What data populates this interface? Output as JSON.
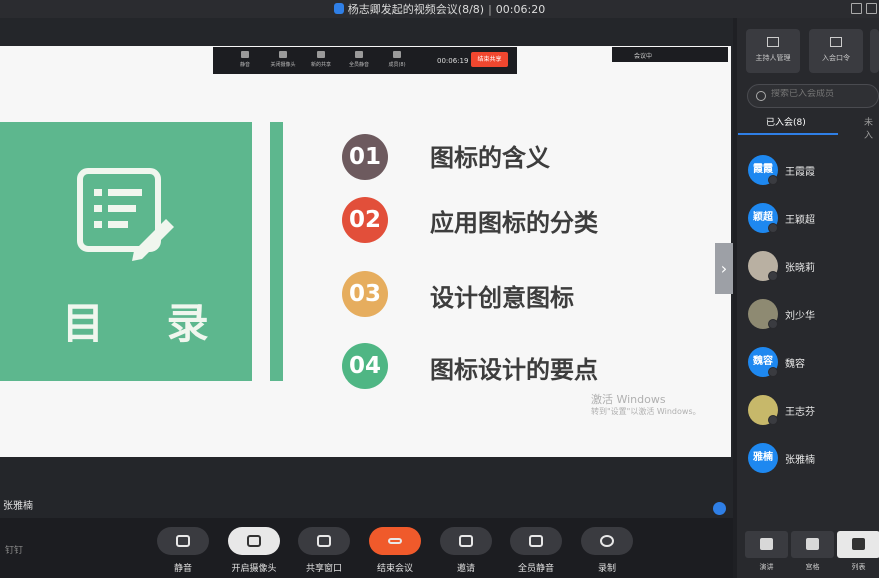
{
  "titlebar": {
    "title": "杨志卿发起的视频会议(8/8)",
    "timer": "00:06:20"
  },
  "slide": {
    "toc": "目 录",
    "items": [
      {
        "num": "01",
        "text": "图标的含义",
        "color": "#6d5a5e"
      },
      {
        "num": "02",
        "text": "应用图标的分类",
        "color": "#e24f3a"
      },
      {
        "num": "03",
        "text": "设计创意图标",
        "color": "#e6ad5e"
      },
      {
        "num": "04",
        "text": "图标设计的要点",
        "color": "#4fb684"
      }
    ],
    "watermark_line1": "激活 Windows",
    "watermark_line2": "转到\"设置\"以激活 Windows。"
  },
  "share_bar": {
    "tools": [
      "静音",
      "关闭摄像头",
      "新的共享",
      "全员静音",
      "成员(8)"
    ],
    "time": "00:06:19",
    "stop_label": "结束共享",
    "status": "会议中"
  },
  "speaker_name": "张雅楠",
  "brand": "钉钉",
  "bottom_toolbar": [
    {
      "label": "静音",
      "icon": "microphone-icon"
    },
    {
      "label": "开启摄像头",
      "icon": "camera-off-icon"
    },
    {
      "label": "共享窗口",
      "icon": "share-window-icon"
    },
    {
      "label": "结束会议",
      "icon": "hang-up-icon",
      "color": "#f05a2b"
    },
    {
      "label": "邀请",
      "icon": "invite-icon"
    },
    {
      "label": "全员静音",
      "icon": "mute-all-icon"
    },
    {
      "label": "录制",
      "icon": "record-icon"
    }
  ],
  "panel": {
    "tools": [
      "主持人管理",
      "入会口令"
    ],
    "search_placeholder": "搜索已入会成员",
    "tab_joined": "已入会(8)",
    "tab_not_joined": "未入",
    "members": [
      {
        "avatar": "霞霞",
        "name": "王霞霞"
      },
      {
        "avatar": "颖超",
        "name": "王颖超"
      },
      {
        "avatar": "",
        "name": "张晓莉"
      },
      {
        "avatar": "",
        "name": "刘少华"
      },
      {
        "avatar": "魏容",
        "name": "魏容"
      },
      {
        "avatar": "",
        "name": "王志芬"
      },
      {
        "avatar": "雅楠",
        "name": "张雅楠"
      }
    ],
    "bottom_tabs": [
      "演讲",
      "宫格",
      "列表"
    ]
  }
}
